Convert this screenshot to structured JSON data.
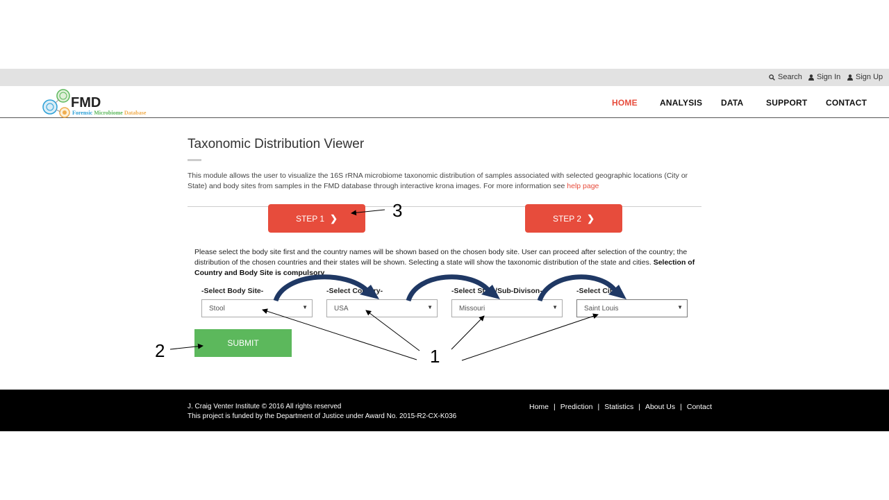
{
  "topbar": {
    "search": "Search",
    "sign_in": "Sign In",
    "sign_up": "Sign Up"
  },
  "logo": {
    "title": "FMD",
    "sub_words": [
      "Forensic",
      "Microbiome",
      "Database"
    ]
  },
  "nav": {
    "items": [
      "HOME",
      "ANALYSIS",
      "DATA",
      "SUPPORT",
      "CONTACT"
    ],
    "active": "HOME"
  },
  "main": {
    "title": "Taxonomic Distribution Viewer",
    "intro": "This module allows the user to visualize the 16S rRNA microbiome taxonomic distribution of samples associated with selected geographic locations (City or State) and body sites from samples in the FMD database through interactive krona images. For more information see",
    "help_link": "help page",
    "step1": "STEP 1",
    "step2": "STEP 2",
    "instructions": "Please select the body site first and the country names will be shown based on the chosen body site. User can proceed after selection of the country; the distribution of the chosen countries and their states will be shown. Selecting a state will show the taxonomic distribution of the state and cities.",
    "instructions_bold": "Selection of Country and Body Site is compulsory",
    "selects": [
      {
        "label": "-Select Body Site-",
        "value": "Stool"
      },
      {
        "label": "-Select Country-",
        "value": "USA"
      },
      {
        "label": "-Select State/Sub-Divison-",
        "value": "Missouri"
      },
      {
        "label": "-Select City-",
        "value": "Saint Louis"
      }
    ],
    "submit": "SUBMIT"
  },
  "annotations": {
    "one": "1",
    "two": "2",
    "three": "3"
  },
  "footer": {
    "copyright": "J. Craig Venter Institute © 2016 All rights reserved",
    "funding": "This project is funded by the Department of Justice under Award No. 2015-R2-CX-K036",
    "links": [
      "Home",
      "Prediction",
      "Statistics",
      "About Us",
      "Contact"
    ]
  },
  "colors": {
    "accent_red": "#e74c3c",
    "submit_green": "#5cb85c",
    "arrow_blue": "#1f3864"
  }
}
